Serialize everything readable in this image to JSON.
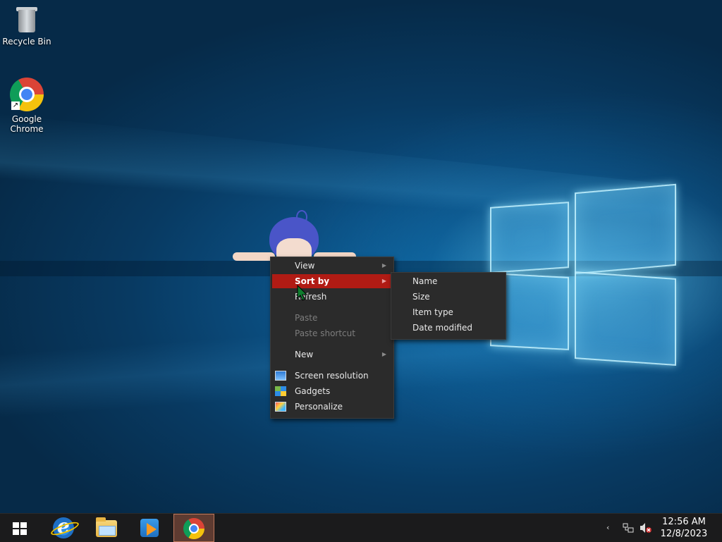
{
  "desktop": {
    "icons": [
      {
        "label": "Recycle Bin"
      },
      {
        "label": "Google Chrome"
      }
    ]
  },
  "context_menu": {
    "items": [
      {
        "label": "View",
        "has_submenu": true,
        "enabled": true
      },
      {
        "label": "Sort by",
        "has_submenu": true,
        "enabled": true,
        "selected": true
      },
      {
        "label": "Refresh",
        "enabled": true
      },
      {
        "label": "Paste",
        "enabled": false
      },
      {
        "label": "Paste shortcut",
        "enabled": false
      },
      {
        "label": "New",
        "has_submenu": true,
        "enabled": true
      },
      {
        "label": "Screen resolution",
        "icon": "screen-resolution-icon",
        "enabled": true
      },
      {
        "label": "Gadgets",
        "icon": "gadgets-icon",
        "enabled": true
      },
      {
        "label": "Personalize",
        "icon": "personalize-icon",
        "enabled": true
      }
    ],
    "sort_by_submenu": [
      {
        "label": "Name"
      },
      {
        "label": "Size"
      },
      {
        "label": "Item type"
      },
      {
        "label": "Date modified"
      }
    ],
    "highlight_color": "#b11b14"
  },
  "taskbar": {
    "apps": [
      {
        "name": "start-button",
        "icon": "windows-logo-icon"
      },
      {
        "name": "internet-explorer",
        "icon": "internet-explorer-icon"
      },
      {
        "name": "file-explorer",
        "icon": "file-explorer-icon"
      },
      {
        "name": "media-player",
        "icon": "media-player-icon"
      },
      {
        "name": "google-chrome",
        "icon": "chrome-icon",
        "active": true
      }
    ],
    "tray": {
      "time": "12:56 AM",
      "date": "12/8/2023",
      "overflow_glyph": "‹"
    }
  }
}
